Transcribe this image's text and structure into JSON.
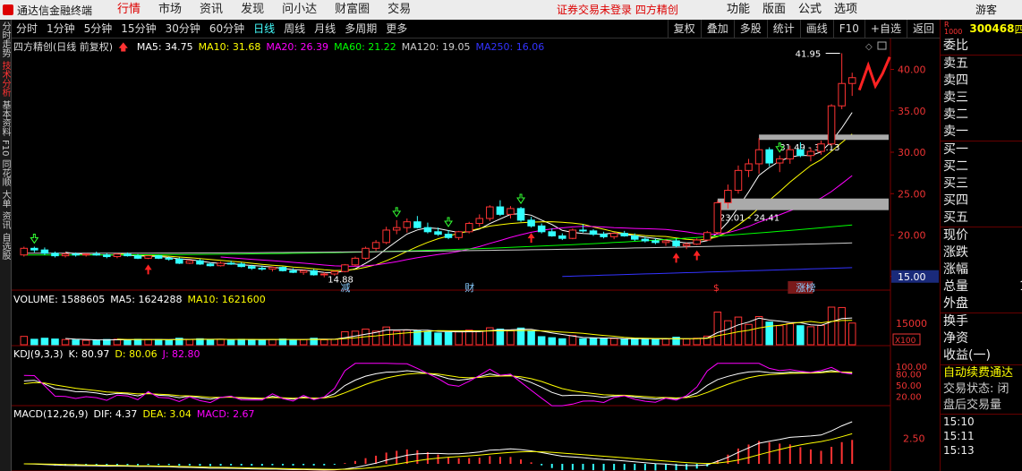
{
  "app": {
    "title": "通达信金融终端"
  },
  "top_menu": [
    {
      "label": "行情",
      "active": true
    },
    {
      "label": "市场",
      "active": false
    },
    {
      "label": "资讯",
      "active": false
    },
    {
      "label": "发现",
      "active": false
    },
    {
      "label": "问小达",
      "active": false
    },
    {
      "label": "财富圈",
      "active": false
    },
    {
      "label": "交易",
      "active": false
    }
  ],
  "trade_warning": "证券交易未登录  四方精创",
  "right_menu": [
    "功能",
    "版面",
    "公式",
    "选项"
  ],
  "guest_label": "游客",
  "left_tabs": [
    {
      "label": "分时走势",
      "active": false
    },
    {
      "label": "技术分析",
      "active": true
    },
    {
      "label": "基本资料",
      "active": false
    },
    {
      "label": "F10",
      "active": false
    },
    {
      "label": "同花顺",
      "active": false
    },
    {
      "label": "大单",
      "active": false
    },
    {
      "label": "资讯",
      "active": false
    },
    {
      "label": "自选股",
      "active": false
    }
  ],
  "periods": [
    {
      "label": "分时",
      "active": false
    },
    {
      "label": "1分钟",
      "active": false
    },
    {
      "label": "5分钟",
      "active": false
    },
    {
      "label": "15分钟",
      "active": false
    },
    {
      "label": "30分钟",
      "active": false
    },
    {
      "label": "60分钟",
      "active": false
    },
    {
      "label": "日线",
      "active": true
    },
    {
      "label": "周线",
      "active": false
    },
    {
      "label": "月线",
      "active": false
    },
    {
      "label": "多周期",
      "active": false
    },
    {
      "label": "更多",
      "active": false
    }
  ],
  "tools": [
    "复权",
    "叠加",
    "多股",
    "统计",
    "画线",
    "F10",
    "+自选",
    "返回"
  ],
  "main_chart": {
    "title": "四方精创(日线 前复权)",
    "indicators": [
      {
        "label": "MA5: 34.75",
        "color": "#ffffff"
      },
      {
        "label": "MA10: 31.68",
        "color": "#ffff00"
      },
      {
        "label": "MA20: 26.39",
        "color": "#ff00ff"
      },
      {
        "label": "MA60: 21.22",
        "color": "#00ff00"
      },
      {
        "label": "MA120: 19.05",
        "color": "#cccccc"
      },
      {
        "label": "MA250: 16.06",
        "color": "#3333ff"
      }
    ],
    "y_ticks": [
      "40.00",
      "35.00",
      "30.00",
      "25.00",
      "20.00",
      "15.00"
    ],
    "current_price_tag": "15.00",
    "high_label": "41.95",
    "low_label": "14.88",
    "zone1_label": "31.49 - 32.13",
    "zone2_label": "23.01 - 24.41",
    "event_labels": [
      "减",
      "财",
      "$",
      "涨榜"
    ]
  },
  "volume_pane": {
    "indicators": [
      {
        "label": "VOLUME: 1588605",
        "color": "#ffffff"
      },
      {
        "label": "MA5: 1624288",
        "color": "#ffffff"
      },
      {
        "label": "MA10: 1621600",
        "color": "#ffff00"
      }
    ],
    "y_tick": "15000",
    "unit": "X100"
  },
  "kdj_pane": {
    "indicators": [
      {
        "label": "KDJ(9,3,3)",
        "color": "#ffffff"
      },
      {
        "label": "K: 80.97",
        "color": "#ffffff"
      },
      {
        "label": "D: 80.06",
        "color": "#ffff00"
      },
      {
        "label": "J: 82.80",
        "color": "#ff00ff"
      }
    ],
    "y_ticks": [
      "100.00",
      "80.00",
      "50.00",
      "20.00"
    ]
  },
  "macd_pane": {
    "indicators": [
      {
        "label": "MACD(12,26,9)",
        "color": "#ffffff"
      },
      {
        "label": "DIF: 4.37",
        "color": "#ffffff"
      },
      {
        "label": "DEA: 3.04",
        "color": "#ffff00"
      },
      {
        "label": "MACD: 2.67",
        "color": "#ff00ff"
      }
    ],
    "y_tick": "2.50"
  },
  "right_panel": {
    "badge": "R",
    "badge_sub": "1000",
    "code": "300468",
    "code_suffix": "四",
    "rows_ratio": "委比",
    "sell_levels": [
      "卖五",
      "卖四",
      "卖三",
      "卖二",
      "卖一"
    ],
    "buy_levels": [
      "买一",
      "买二",
      "买三",
      "买四",
      "买五"
    ],
    "stats": [
      "现价",
      "涨跌",
      "涨幅",
      "总量",
      "外盘"
    ],
    "total_volume_value": "1",
    "stats2": [
      "换手",
      "净资",
      "收益(一)"
    ],
    "auto_renew": "自动续费通达",
    "trade_state": "交易状态: 闭",
    "after_volume": "盘后交易量",
    "times": [
      "15:10",
      "15:11",
      "15:13"
    ]
  },
  "chart_data": {
    "type": "candlestick",
    "up_color": "#ff3333",
    "down_color": "#33ffff",
    "ohlc": [
      [
        17.6,
        18.6,
        17.4,
        18.4
      ],
      [
        18.4,
        18.6,
        17.9,
        18.2
      ],
      [
        18.2,
        18.5,
        17.6,
        17.8
      ],
      [
        17.8,
        18.0,
        17.3,
        17.5
      ],
      [
        17.5,
        17.9,
        17.3,
        17.7
      ],
      [
        17.7,
        17.9,
        17.4,
        17.6
      ],
      [
        17.6,
        17.8,
        17.4,
        17.7
      ],
      [
        17.7,
        18.0,
        17.5,
        17.6
      ],
      [
        17.6,
        17.8,
        17.2,
        17.4
      ],
      [
        17.4,
        17.8,
        17.2,
        17.7
      ],
      [
        17.7,
        17.9,
        17.4,
        17.5
      ],
      [
        17.5,
        17.7,
        17.1,
        17.2
      ],
      [
        17.2,
        17.6,
        17.1,
        17.5
      ],
      [
        17.5,
        17.6,
        17.1,
        17.2
      ],
      [
        17.2,
        17.4,
        16.9,
        17.1
      ],
      [
        17.1,
        17.3,
        16.5,
        16.6
      ],
      [
        16.6,
        17.0,
        16.5,
        16.9
      ],
      [
        16.9,
        17.1,
        16.4,
        16.5
      ],
      [
        16.5,
        16.7,
        16.2,
        16.3
      ],
      [
        16.3,
        16.8,
        16.2,
        16.6
      ],
      [
        16.6,
        16.9,
        16.4,
        16.5
      ],
      [
        16.5,
        16.7,
        16.1,
        16.2
      ],
      [
        16.2,
        16.4,
        15.8,
        16.0
      ],
      [
        16.0,
        16.3,
        15.7,
        15.9
      ],
      [
        15.9,
        16.2,
        15.6,
        16.1
      ],
      [
        16.1,
        16.2,
        15.6,
        15.7
      ],
      [
        15.7,
        16.0,
        15.4,
        15.5
      ],
      [
        15.5,
        15.8,
        15.2,
        15.7
      ],
      [
        15.7,
        15.9,
        15.1,
        15.2
      ],
      [
        15.2,
        15.5,
        14.9,
        15.3
      ],
      [
        15.3,
        15.7,
        15.1,
        15.6
      ],
      [
        15.6,
        16.5,
        15.5,
        16.4
      ],
      [
        16.4,
        17.4,
        16.2,
        17.2
      ],
      [
        17.2,
        18.6,
        17.0,
        18.4
      ],
      [
        18.4,
        19.4,
        18.1,
        19.1
      ],
      [
        19.1,
        21.0,
        18.9,
        20.6
      ],
      [
        20.6,
        21.8,
        20.1,
        20.9
      ],
      [
        20.9,
        22.0,
        20.3,
        21.6
      ],
      [
        21.6,
        22.3,
        20.8,
        20.9
      ],
      [
        20.9,
        21.5,
        20.2,
        20.4
      ],
      [
        20.4,
        20.9,
        19.9,
        20.1
      ],
      [
        20.1,
        20.6,
        19.5,
        19.7
      ],
      [
        19.7,
        20.5,
        19.4,
        20.4
      ],
      [
        20.4,
        21.6,
        20.2,
        21.4
      ],
      [
        21.4,
        22.5,
        21.0,
        22.0
      ],
      [
        22.0,
        23.6,
        21.7,
        23.4
      ],
      [
        23.4,
        24.2,
        22.3,
        22.5
      ],
      [
        22.5,
        23.5,
        22.0,
        23.2
      ],
      [
        23.2,
        23.4,
        21.6,
        21.8
      ],
      [
        21.8,
        22.2,
        20.9,
        21.1
      ],
      [
        21.1,
        21.4,
        20.2,
        20.4
      ],
      [
        20.4,
        20.8,
        19.8,
        19.9
      ],
      [
        19.9,
        20.2,
        19.4,
        19.6
      ],
      [
        19.6,
        20.8,
        19.5,
        20.6
      ],
      [
        20.6,
        21.3,
        20.3,
        20.5
      ],
      [
        20.5,
        20.7,
        19.9,
        20.1
      ],
      [
        20.1,
        20.4,
        19.6,
        19.8
      ],
      [
        19.8,
        20.3,
        19.5,
        20.2
      ],
      [
        20.2,
        20.5,
        19.8,
        19.9
      ],
      [
        19.9,
        20.2,
        19.3,
        19.5
      ],
      [
        19.5,
        19.8,
        19.1,
        19.3
      ],
      [
        19.3,
        19.6,
        18.9,
        19.1
      ],
      [
        19.1,
        19.5,
        18.7,
        19.3
      ],
      [
        19.3,
        19.6,
        18.5,
        18.7
      ],
      [
        18.7,
        19.1,
        18.3,
        18.9
      ],
      [
        18.9,
        19.6,
        18.8,
        19.4
      ],
      [
        19.4,
        20.5,
        19.3,
        20.3
      ],
      [
        20.3,
        24.2,
        20.1,
        23.9
      ],
      [
        23.9,
        26.1,
        23.2,
        25.4
      ],
      [
        25.4,
        28.4,
        25.0,
        27.8
      ],
      [
        27.8,
        29.2,
        27.0,
        28.6
      ],
      [
        28.6,
        31.7,
        27.4,
        30.3
      ],
      [
        30.3,
        30.6,
        28.3,
        28.7
      ],
      [
        28.7,
        29.6,
        27.6,
        29.2
      ],
      [
        29.2,
        30.8,
        28.6,
        30.3
      ],
      [
        30.3,
        31.2,
        29.4,
        29.6
      ],
      [
        29.6,
        30.5,
        28.9,
        30.1
      ],
      [
        30.1,
        31.4,
        29.7,
        31.0
      ],
      [
        31.0,
        35.8,
        30.8,
        35.6
      ],
      [
        35.6,
        41.95,
        35.2,
        38.3
      ],
      [
        38.3,
        39.6,
        36.8,
        39.0
      ]
    ],
    "ma5_end": 34.75,
    "ma10_end": 31.68,
    "ma20_end": 26.39,
    "ma60_end": 21.22,
    "ma120_end": 19.05,
    "ma250_end": 16.06,
    "ylim": [
      14,
      42
    ]
  }
}
